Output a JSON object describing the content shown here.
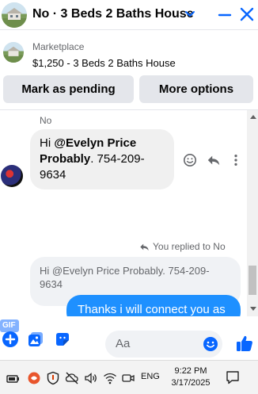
{
  "header": {
    "title": "No · 3 Beds 2 Baths House"
  },
  "listing": {
    "label": "Marketplace",
    "title": "$1,250 - 3 Beds 2 Baths House"
  },
  "actions": {
    "mark_pending": "Mark as pending",
    "more_options": "More options"
  },
  "messages": {
    "incoming": {
      "sender": "No",
      "mention": "@Evelyn Price Probably",
      "text": ". 754-209-9634"
    },
    "reply_note": "You replied to No",
    "quoted": "Hi @Evelyn Price Probably. 754-209-9634",
    "outgoing": "Thanks i will connect you as"
  },
  "composer": {
    "placeholder": "Aa",
    "gif_label": "GIF"
  },
  "taskbar": {
    "language": "ENG",
    "time": "9:22 PM",
    "date": "3/17/2025"
  },
  "colors": {
    "accent": "#0866ff",
    "outgoing_bubble": "#1e90ff"
  }
}
